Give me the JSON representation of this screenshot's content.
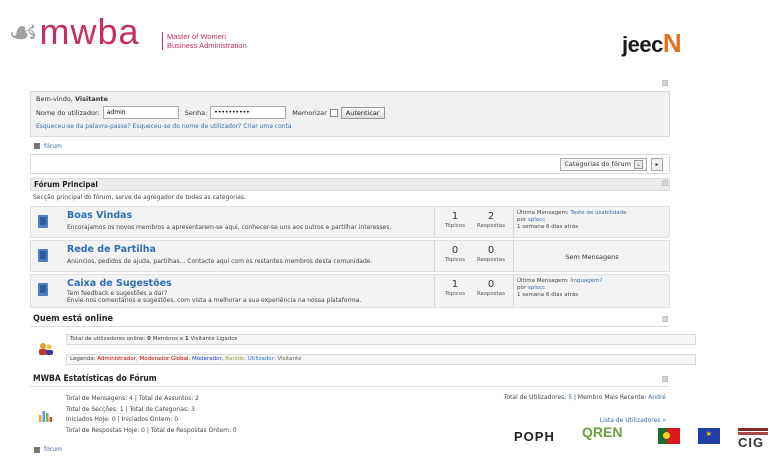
{
  "header": {
    "logo_text": "mwba",
    "logo_subtitle_1": "Master of Women",
    "logo_subtitle_2": "Business Administration",
    "partner_logo_a": "jeec",
    "partner_logo_b": "N"
  },
  "login": {
    "welcome_prefix": "Bem-vindo,",
    "welcome_user": "Visitante",
    "username_label": "Nome do utilizador:",
    "username_value": "admin",
    "password_label": "Senha:",
    "password_value": "••••••••••",
    "remember_label": "Memorizar",
    "submit_label": "Autenticar",
    "forgot_password": "Esqueceu-se da palavra-passe?",
    "forgot_username": "Esqueceu-se do nome de utilizador?",
    "create_account": "Criar uma conta"
  },
  "breadcrumb": {
    "label": "fórum"
  },
  "category_select": {
    "selected": "Categorias do fórum",
    "go_label": "▸"
  },
  "section": {
    "title": "Fórum Principal",
    "description": "Secção principal do fórum, serve de agregador de todas as categorias."
  },
  "forums": [
    {
      "name": "Boas Vindas",
      "description": "Encorajamos os novos membros a apresentarem-se aqui, conhecer-se uns aos outros e partilhar interesses.",
      "topics": "1",
      "topics_label": "Tópicos",
      "replies": "2",
      "replies_label": "Respostas",
      "last_label": "Última Mensagem:",
      "last_title": "Teste de usabilidade",
      "last_by_label": "por",
      "last_by": "splocc",
      "last_when": "1 semana 6 dias atrás"
    },
    {
      "name": "Rede de Partilha",
      "description": "Anúncios, pedidos de ajuda, partilhas... Contacte aqui com os restantes membros desta comunidade.",
      "topics": "0",
      "topics_label": "Tópicos",
      "replies": "0",
      "replies_label": "Respostas",
      "no_messages": "Sem Mensagens"
    },
    {
      "name": "Caixa de Sugestões",
      "description_1": "Tem feedback e sugestões a dar?",
      "description_2": "Envie-nos comentários e sugestões, com vista a melhorar a sua experiência na nossa plataforma.",
      "topics": "1",
      "topics_label": "Tópicos",
      "replies": "0",
      "replies_label": "Respostas",
      "last_label": "Última Mensagem:",
      "last_title": "linguagem?",
      "last_by_label": "por",
      "last_by": "splocc",
      "last_when": "1 semana 6 dias atrás"
    }
  ],
  "online": {
    "title": "Quem está online",
    "summary_prefix": "Total de utilizadores online:",
    "summary_members": "0",
    "summary_members_label": "Membros e",
    "summary_visitors": "1",
    "summary_visitors_label": "Visitante Ligados",
    "legend_label": "Legenda:",
    "legend_admin": "Administrador,",
    "legend_gmod": "Moderador Global,",
    "legend_mod": "Moderador,",
    "legend_banned": "Banido,",
    "legend_user": "Utilizador,",
    "legend_visitor": "Visitante"
  },
  "stats": {
    "title": "MWBA Estatísticas do Fórum",
    "line1": "Total de Mensagens: 4 | Total de Assuntos: 2",
    "line2": "Total de Secções: 1 | Total de Categorias: 3",
    "line3": "Iniciados Hoje: 0 | Iniciados Ontem: 0",
    "line4": "Total de Respostas Hoje: 0 | Total de Respostas Ontem: 0",
    "users_label": "Total de Utilizadores:",
    "users_value": "5",
    "newest_label": "Membro Mais Recente:",
    "newest_value": "André",
    "user_list_link": "Lista de Utilizadores »"
  },
  "footer_breadcrumb": {
    "label": "fórum"
  },
  "sponsors": {
    "poph": "POPH",
    "qren": "QREN",
    "cig": "CIG"
  }
}
